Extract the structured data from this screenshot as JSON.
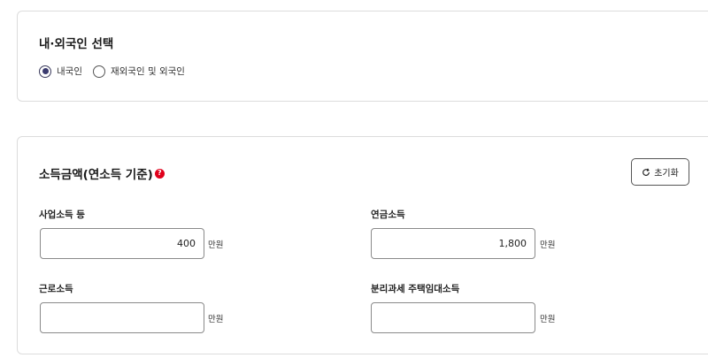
{
  "nationality": {
    "title": "내·외국인 선택",
    "options": [
      {
        "label": "내국인",
        "selected": true
      },
      {
        "label": "재외국인 및 외국인",
        "selected": false
      }
    ]
  },
  "income": {
    "title": "소득금액(연소득 기준)",
    "help_icon": "question-icon",
    "reset_label": "초기화",
    "fields": [
      {
        "label": "사업소득 등",
        "value": "400",
        "unit": "만원"
      },
      {
        "label": "연금소득",
        "value": "1,800",
        "unit": "만원"
      },
      {
        "label": "근로소득",
        "value": "",
        "unit": "만원"
      },
      {
        "label": "분리과세 주택임대소득",
        "value": "",
        "unit": "만원"
      }
    ]
  },
  "colors": {
    "accent_radio": "#3b3b6f",
    "help_icon": "#e0001b",
    "border": "#dcdcdc"
  }
}
